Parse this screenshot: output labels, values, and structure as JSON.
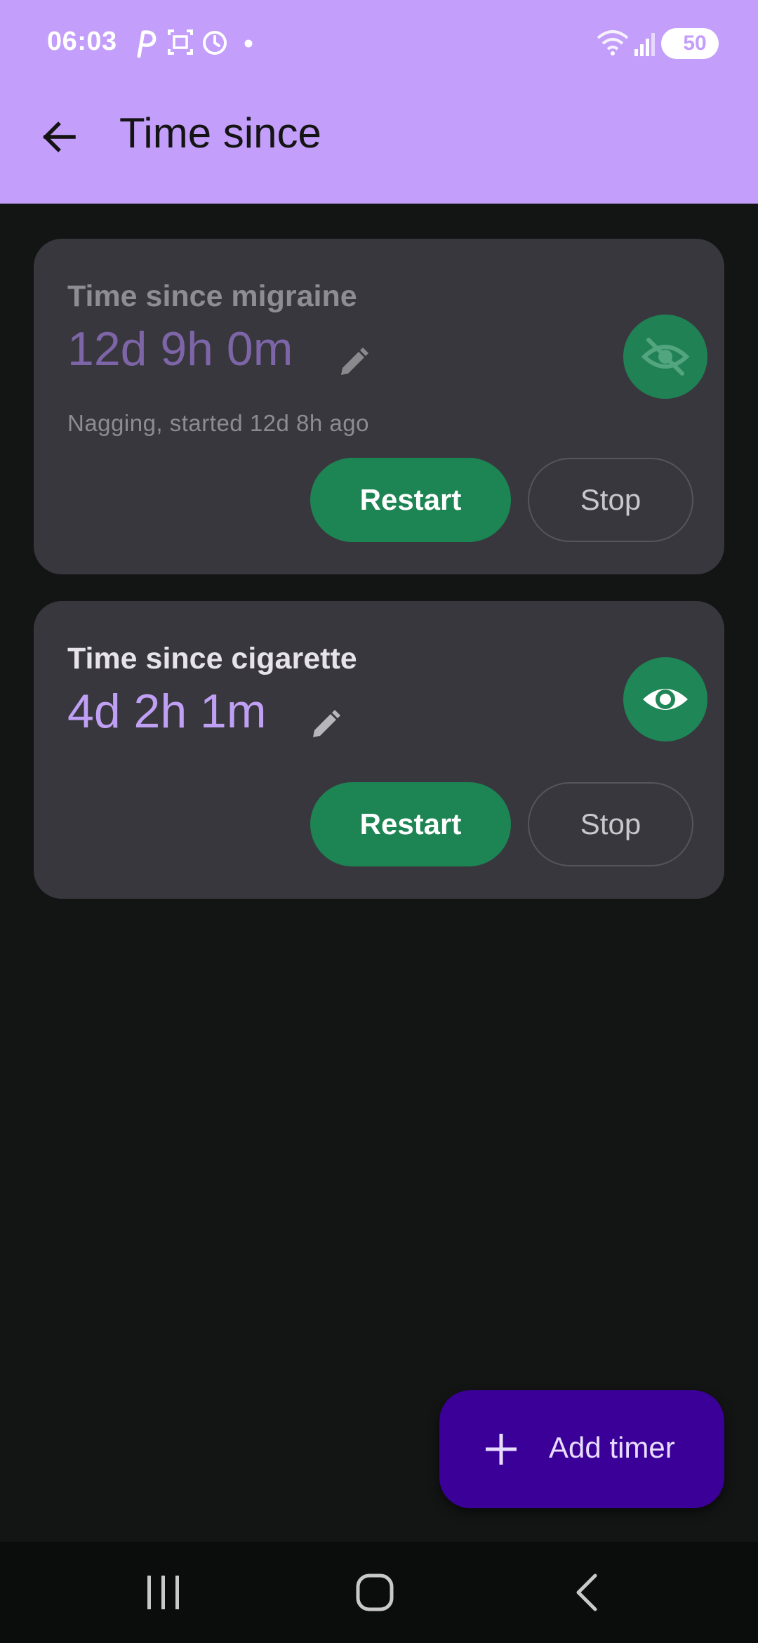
{
  "status_bar": {
    "time": "06:03",
    "battery": "50",
    "icons": [
      "p-app-icon",
      "screenshot-icon",
      "alarm-icon",
      "dot-icon",
      "wifi-icon",
      "signal-icon",
      "battery-icon"
    ]
  },
  "header": {
    "title": "Time since",
    "back_icon": "arrow-back-icon"
  },
  "timers": [
    {
      "title": "Time since migraine",
      "elapsed": "12d 9h 0m",
      "subtitle": "Nagging, started 12d 8h ago",
      "visibility_icon": "eye-off-icon",
      "restart_label": "Restart",
      "stop_label": "Stop"
    },
    {
      "title": "Time since cigarette",
      "elapsed": "4d 2h 1m",
      "visibility_icon": "eye-icon",
      "restart_label": "Restart",
      "stop_label": "Stop"
    }
  ],
  "fab": {
    "label": "Add timer",
    "icon": "plus-icon"
  },
  "nav_bar": {
    "icons": [
      "recents-icon",
      "home-icon",
      "back-icon"
    ]
  },
  "colors": {
    "app_bar": "#c39efa",
    "background": "#131414",
    "card": "#38373d",
    "accent_green": "#1d8453",
    "fab": "#3b0098",
    "elapsed_muted": "#7d65a8",
    "elapsed_active": "#c0a0f4"
  }
}
